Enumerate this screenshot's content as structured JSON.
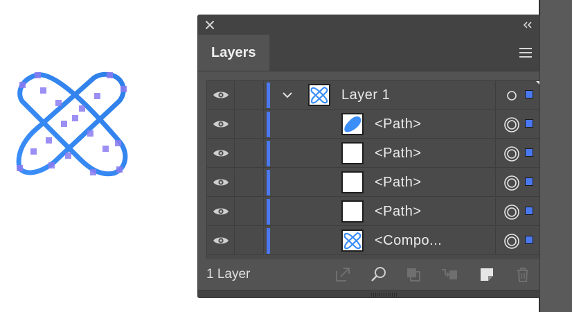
{
  "panel": {
    "tab_label": "Layers",
    "footer_label": "1 Layer",
    "accent_color": "#4a78f0",
    "rows": [
      {
        "name": "Layer 1",
        "type": "layer",
        "thumb": "compound-icon"
      },
      {
        "name": "<Path>",
        "type": "path",
        "thumb": "blue-shape"
      },
      {
        "name": "<Path>",
        "type": "path",
        "thumb": "blank"
      },
      {
        "name": "<Path>",
        "type": "path",
        "thumb": "blank"
      },
      {
        "name": "<Path>",
        "type": "path",
        "thumb": "blank"
      },
      {
        "name": "<Compo...",
        "type": "path",
        "thumb": "compound-icon"
      }
    ],
    "footer_icons": [
      "export-icon",
      "locate-object-icon",
      "make-clipping-mask-icon",
      "create-sublayer-icon",
      "new-layer-icon",
      "trash-icon"
    ]
  }
}
